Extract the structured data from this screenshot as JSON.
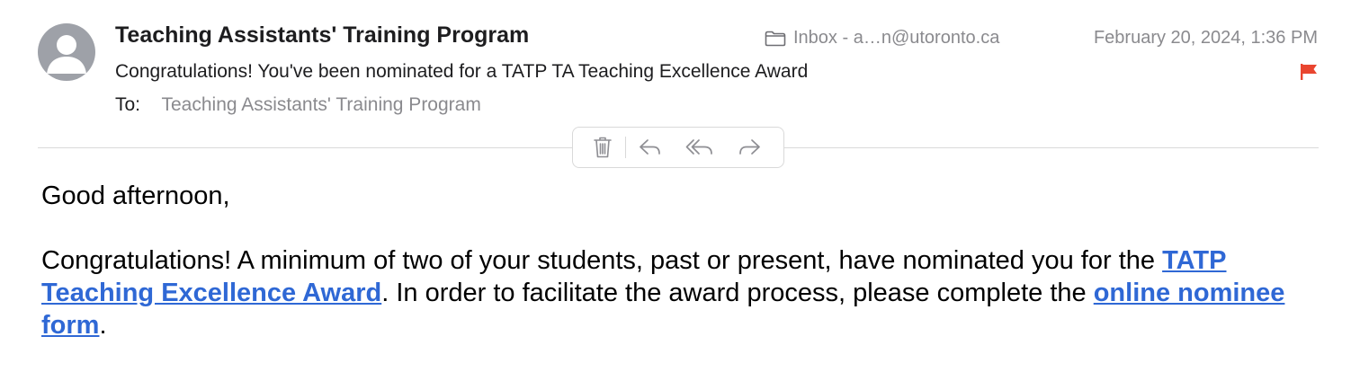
{
  "header": {
    "sender": "Teaching Assistants' Training Program",
    "mailbox": "Inbox - a…n@utoronto.ca",
    "date": "February 20, 2024, 1:36 PM",
    "subject": "Congratulations! You've been nominated for a TATP TA Teaching Excellence Award",
    "to_label": "To:",
    "to_value": "Teaching Assistants' Training Program",
    "flag_color": "#e9452f",
    "avatar_color": "#9ea1a8"
  },
  "toolbar": {
    "icons": [
      "trash-icon",
      "reply-icon",
      "reply-all-icon",
      "forward-icon"
    ]
  },
  "message": {
    "greeting": "Good afternoon,",
    "p1_start": "Congratulations! A minimum of two of your students, past or present, have nominated you for the ",
    "link1": "TATP Teaching Excellence Award",
    "p1_mid": ". In order to facilitate the award process, please complete the ",
    "link2": "online nominee form",
    "p1_end": ".",
    "link_color": "#2f68d5"
  }
}
